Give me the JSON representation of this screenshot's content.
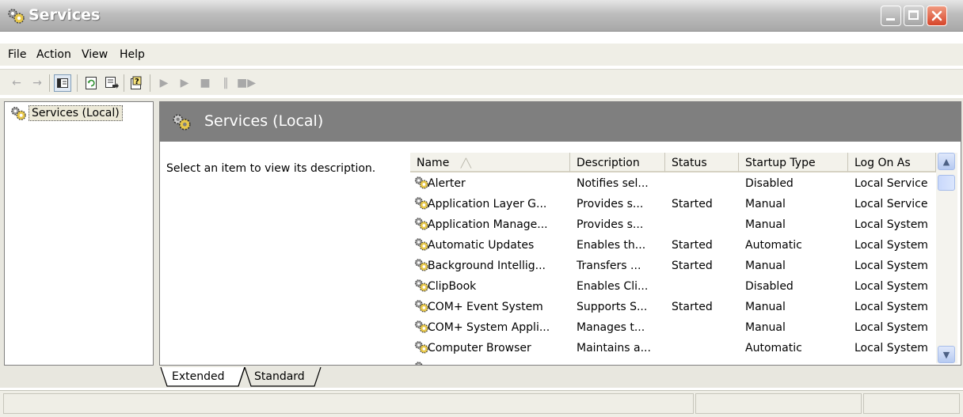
{
  "window": {
    "title": "Services"
  },
  "menu": [
    {
      "label": "File"
    },
    {
      "label": "Action"
    },
    {
      "label": "View"
    },
    {
      "label": "Help"
    }
  ],
  "toolbar": {
    "buttons": [
      "back-icon",
      "forward-icon",
      "show-hide-tree-icon",
      "refresh-icon",
      "export-list-icon",
      "help-icon",
      "start-service-icon",
      "start-service-alt-icon",
      "stop-service-icon",
      "pause-service-icon",
      "restart-service-icon"
    ]
  },
  "tree": {
    "root_label": "Services (Local)"
  },
  "header": {
    "title": "Services (Local)"
  },
  "description_pane": {
    "text": "Select an item to view its description."
  },
  "columns": [
    "Name",
    "Description",
    "Status",
    "Startup Type",
    "Log On As"
  ],
  "rows": [
    {
      "name": "Alerter",
      "description": "Notifies sel...",
      "status": "",
      "startup": "Disabled",
      "logon": "Local Service"
    },
    {
      "name": "Application Layer G...",
      "description": "Provides s...",
      "status": "Started",
      "startup": "Manual",
      "logon": "Local Service"
    },
    {
      "name": "Application Manage...",
      "description": "Provides s...",
      "status": "",
      "startup": "Manual",
      "logon": "Local System"
    },
    {
      "name": "Automatic Updates",
      "description": "Enables th...",
      "status": "Started",
      "startup": "Automatic",
      "logon": "Local System"
    },
    {
      "name": "Background Intellig...",
      "description": "Transfers ...",
      "status": "Started",
      "startup": "Manual",
      "logon": "Local System"
    },
    {
      "name": "ClipBook",
      "description": "Enables Cli...",
      "status": "",
      "startup": "Disabled",
      "logon": "Local System"
    },
    {
      "name": "COM+ Event System",
      "description": "Supports S...",
      "status": "Started",
      "startup": "Manual",
      "logon": "Local System"
    },
    {
      "name": "COM+ System Appli...",
      "description": "Manages t...",
      "status": "",
      "startup": "Manual",
      "logon": "Local System"
    },
    {
      "name": "Computer Browser",
      "description": "Maintains a...",
      "status": "",
      "startup": "Automatic",
      "logon": "Local System"
    }
  ],
  "tabs": [
    {
      "label": "Extended"
    },
    {
      "label": "Standard"
    }
  ],
  "colors": {
    "header_bg": "#7f7f7f",
    "title_bar": "#b0b0b0",
    "chrome": "#efeee6"
  }
}
